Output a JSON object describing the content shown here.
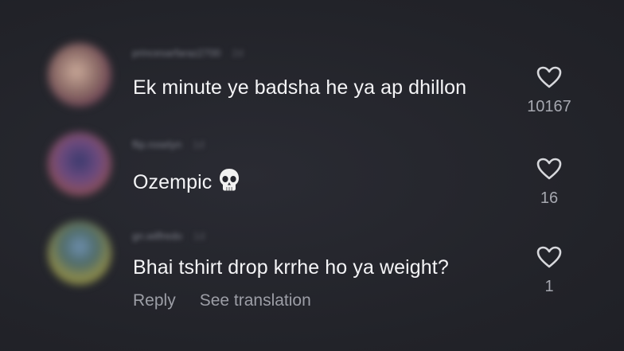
{
  "comments": [
    {
      "username": "princesarfaraz2700",
      "time": "2d",
      "text": "Ek minute ye badsha he ya ap dhillon",
      "likes": "10167",
      "avatar_color": "#b69483"
    },
    {
      "username": "flip.roselyn",
      "time": "1d",
      "text": "Ozempic",
      "emoji_icon": "skull-icon",
      "likes": "16",
      "avatar_color": "#6b4a7e"
    },
    {
      "username": "gn.wilfredo",
      "time": "1d",
      "text": "Bhai tshirt drop krrhe ho ya weight?",
      "likes": "1",
      "avatar_color": "#8b8a4c"
    }
  ],
  "actions": {
    "reply_label": "Reply",
    "translate_label": "See translation"
  },
  "colors": {
    "background": "#24252c",
    "text": "#f4f4f6",
    "muted": "#9c9ea6"
  }
}
